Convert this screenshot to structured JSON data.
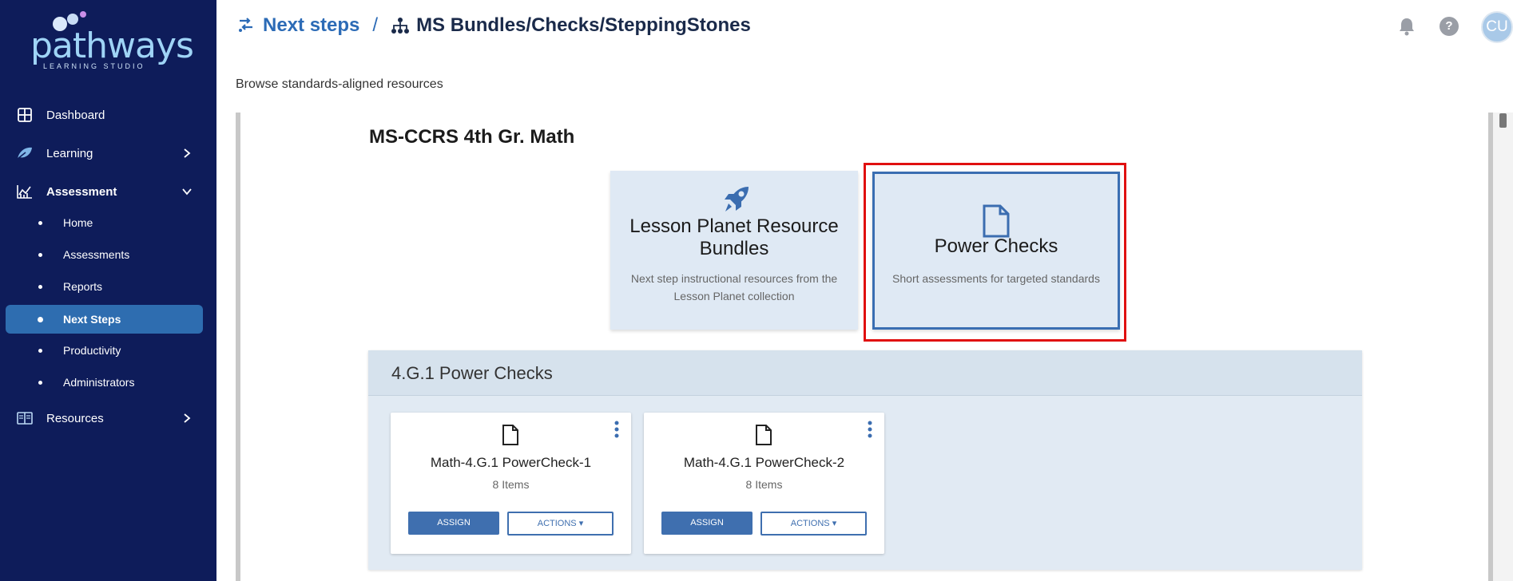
{
  "logo": {
    "word": "pathways",
    "subtitle": "LEARNING STUDIO"
  },
  "sidebar": {
    "items": [
      {
        "label": "Dashboard",
        "icon": "dashboard-grid-icon"
      },
      {
        "label": "Learning",
        "icon": "leaf-icon"
      },
      {
        "label": "Assessment",
        "icon": "chart-line-icon"
      },
      {
        "label": "Resources",
        "icon": "book-icon"
      }
    ],
    "assessment_sub": [
      {
        "label": "Home"
      },
      {
        "label": "Assessments"
      },
      {
        "label": "Reports"
      },
      {
        "label": "Next Steps",
        "active": true
      },
      {
        "label": "Productivity"
      },
      {
        "label": "Administrators"
      }
    ]
  },
  "header": {
    "crumb_root": "Next steps",
    "crumb_separator": "/",
    "crumb_current": "MS Bundles/Checks/SteppingStones",
    "avatar_initials": "CU",
    "help_label": "?"
  },
  "page": {
    "subtitle": "Browse standards-aligned resources",
    "standard_title": "MS-CCRS 4th Gr. Math"
  },
  "bundles": {
    "lesson_planet": {
      "title": "Lesson Planet Resource Bundles",
      "description": "Next step instructional resources from the Lesson Planet collection",
      "icon": "rocket-icon"
    },
    "power_checks": {
      "title": "Power Checks",
      "description": "Short assessments for targeted standards",
      "icon": "document-icon"
    }
  },
  "section": {
    "title": "4.G.1 Power Checks",
    "cards": [
      {
        "title": "Math-4.G.1 PowerCheck-1",
        "count": "8 Items",
        "assign": "ASSIGN",
        "actions": "ACTIONS ▾"
      },
      {
        "title": "Math-4.G.1 PowerCheck-2",
        "count": "8 Items",
        "assign": "ASSIGN",
        "actions": "ACTIONS ▾"
      }
    ]
  },
  "colors": {
    "sidebar_bg": "#0e1c5a",
    "accent": "#2c6bb6",
    "active_item": "#2e6db0",
    "highlight": "#e01010"
  }
}
